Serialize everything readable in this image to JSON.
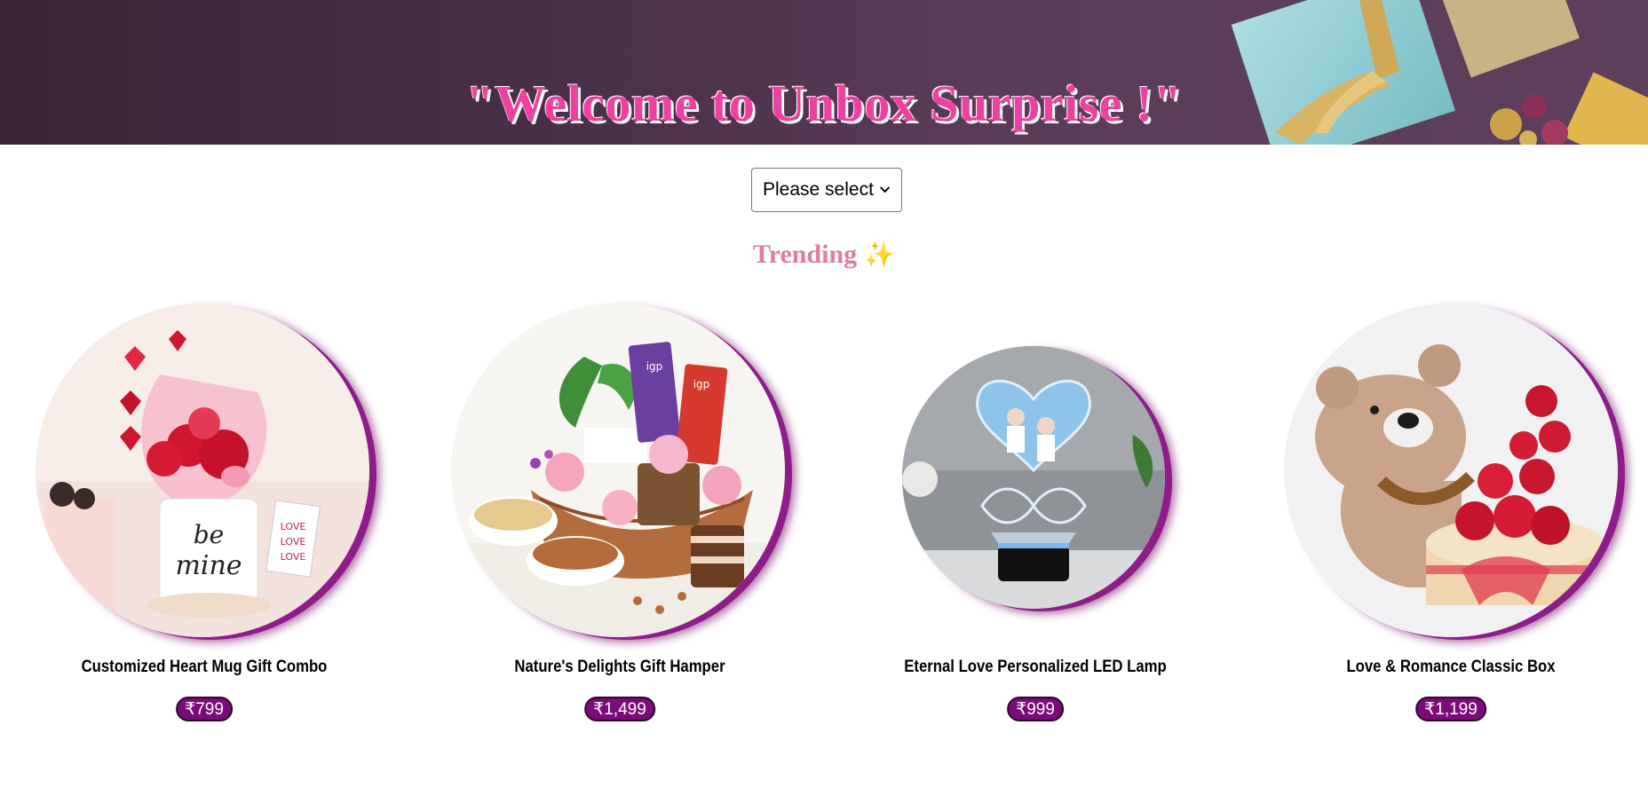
{
  "banner": {
    "title": "\"Welcome to Unbox Surprise !\""
  },
  "category_select": {
    "selected": "Please select"
  },
  "section": {
    "heading": "Trending",
    "heading_icon": "sparkles-icon"
  },
  "products": [
    {
      "name": "Customized Heart Mug Gift Combo",
      "price": "₹799"
    },
    {
      "name": "Nature's Delights Gift Hamper",
      "price": "₹1,499"
    },
    {
      "name": "Eternal Love Personalized LED Lamp",
      "price": "₹999"
    },
    {
      "name": "Love & Romance Classic Box",
      "price": "₹1,199"
    }
  ],
  "colors": {
    "title_pink": "#ef3fa0",
    "trending_pink": "#e07c9c",
    "price_purple": "#7a0c78",
    "disc_shadow": "#8e1c89",
    "banner_bg": "#4a3048"
  }
}
